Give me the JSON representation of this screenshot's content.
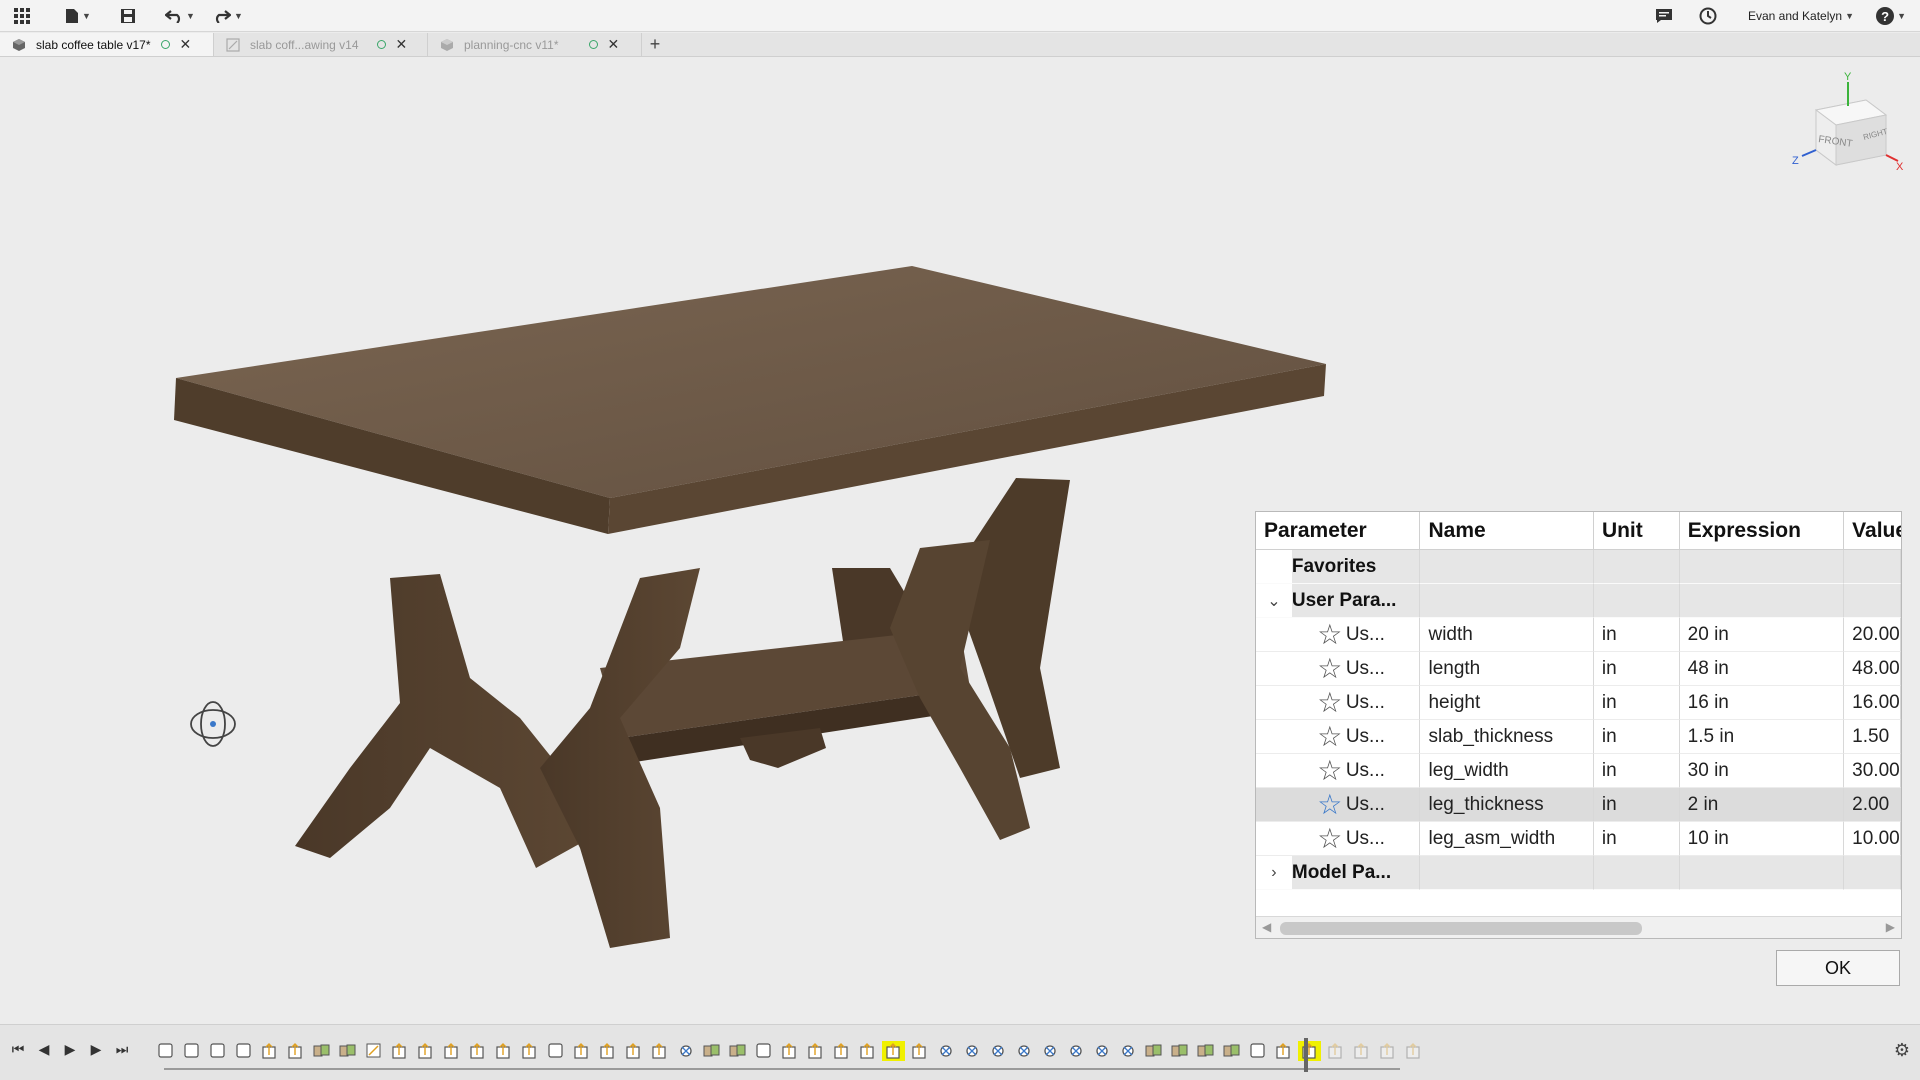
{
  "user": {
    "name": "Evan and Katelyn"
  },
  "tabs": [
    {
      "label": "slab coffee table v17*",
      "active": true
    },
    {
      "label": "slab coff...awing v14",
      "active": false
    },
    {
      "label": "planning-cnc v11*",
      "active": false
    }
  ],
  "viewcube": {
    "front": "FRONT",
    "right": "RIGHT",
    "x": "X",
    "y": "Y",
    "z": "Z"
  },
  "parameters": {
    "columns": {
      "parameter": "Parameter",
      "name": "Name",
      "unit": "Unit",
      "expression": "Expression",
      "value": "Value"
    },
    "groups": {
      "favorites": "Favorites",
      "user": "User Para...",
      "model": "Model Pa..."
    },
    "rows": [
      {
        "type": "Us...",
        "name": "width",
        "unit": "in",
        "expression": "20 in",
        "value": "20.00"
      },
      {
        "type": "Us...",
        "name": "length",
        "unit": "in",
        "expression": "48 in",
        "value": "48.00"
      },
      {
        "type": "Us...",
        "name": "height",
        "unit": "in",
        "expression": "16 in",
        "value": "16.00"
      },
      {
        "type": "Us...",
        "name": "slab_thickness",
        "unit": "in",
        "expression": "1.5 in",
        "value": "1.50"
      },
      {
        "type": "Us...",
        "name": "leg_width",
        "unit": "in",
        "expression": "30 in",
        "value": "30.00"
      },
      {
        "type": "Us...",
        "name": "leg_thickness",
        "unit": "in",
        "expression": "2 in",
        "value": "2.00",
        "selected": true
      },
      {
        "type": "Us...",
        "name": "leg_asm_width",
        "unit": "in",
        "expression": "10 in",
        "value": "10.00"
      }
    ],
    "ok_label": "OK"
  },
  "colors": {
    "wood_top": "#6e5a45",
    "wood_side": "#4f3d2b",
    "accent_blue": "#3a78c9",
    "highlight": "#f0f000"
  }
}
